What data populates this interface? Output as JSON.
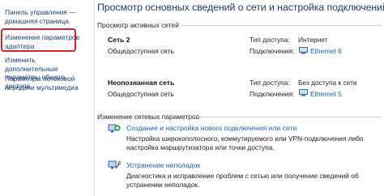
{
  "sidebar": {
    "home": "Панель управления —\nдомашняя страница",
    "adapter": "Изменение параметров\nадаптера",
    "advanced": "Изменить дополнительные\nпараметры общего доступа",
    "media": "Параметры потоковой\nпередачи мультимедиа",
    "highlight_color": "#d8232a"
  },
  "main": {
    "title": "Просмотр основных сведений о сети и настройка подключений",
    "active_networks_header": "Просмотр активных сетей",
    "networks": [
      {
        "name": "Сеть 2",
        "category": "Общедоступная сеть",
        "access_label": "Тип доступа:",
        "access_value": "Интернет",
        "connections_label": "Подключения:",
        "connection": "Ethernet 6"
      },
      {
        "name": "Неопознанная сеть",
        "category": "Общедоступная сеть",
        "access_label": "Тип доступа:",
        "access_value": "Без доступа к сети",
        "connections_label": "Подключения:",
        "connection": "Ethernet 5"
      }
    ],
    "change_settings_header": "Изменение сетевых параметров",
    "tasks": [
      {
        "icon": "network-setup-icon",
        "link": "Создание и настройка нового подключения или сети",
        "description": "Настройка широкополосного, коммутируемого или VPN-подключения либо настройка маршрутизатора или точки доступа."
      },
      {
        "icon": "troubleshoot-icon",
        "link": "Устранение неполадок",
        "description": "Диагностика и исправление проблем с сетью или получение сведений об устранении неполадок."
      }
    ],
    "link_color": "#1a5fb4"
  }
}
